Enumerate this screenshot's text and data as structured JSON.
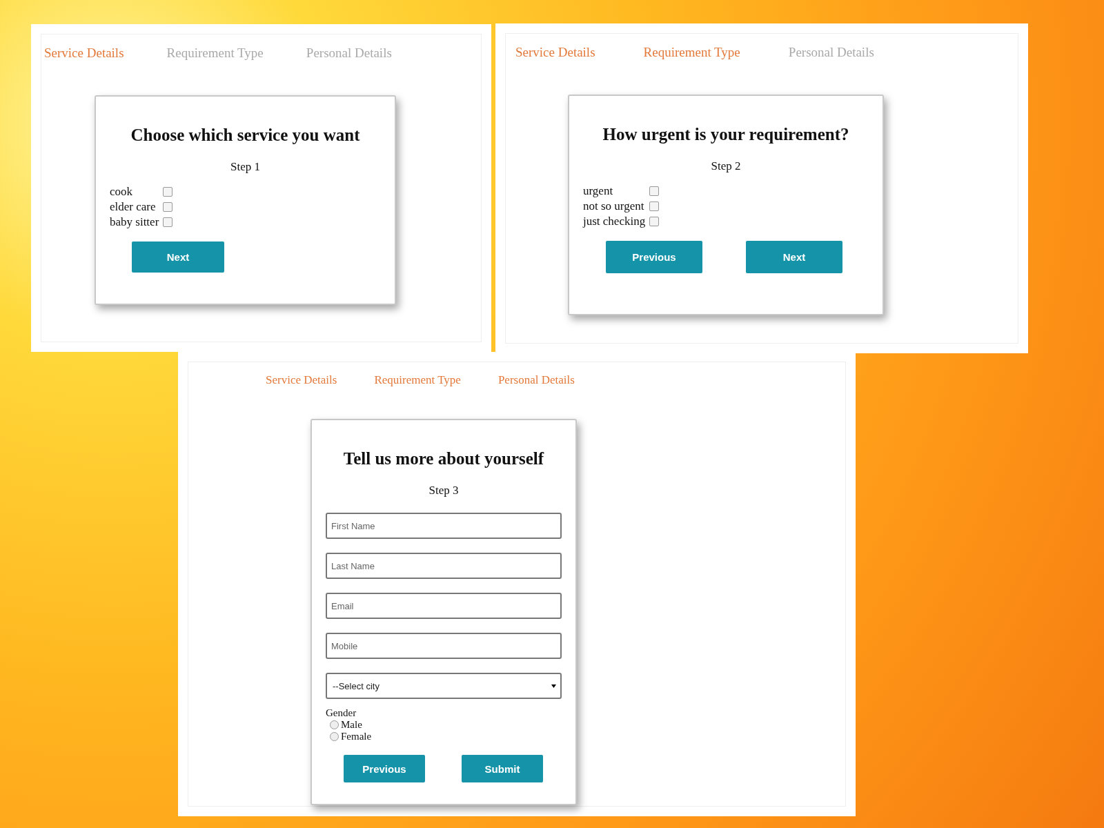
{
  "panels": [
    {
      "tabs": [
        {
          "label": "Service Details",
          "selected": true
        },
        {
          "label": "Requirement Type",
          "selected": false
        },
        {
          "label": "Personal Details",
          "selected": false
        }
      ],
      "title": "Choose which service you want",
      "step": "Step 1",
      "options": [
        {
          "label": "cook",
          "checked": false
        },
        {
          "label": "elder care",
          "checked": false
        },
        {
          "label": "baby sitter",
          "checked": false
        }
      ],
      "buttons": [
        {
          "label": "Next"
        }
      ]
    },
    {
      "tabs": [
        {
          "label": "Service Details",
          "selected": true
        },
        {
          "label": "Requirement Type",
          "selected": true
        },
        {
          "label": "Personal Details",
          "selected": false
        }
      ],
      "title": "How urgent is your requirement?",
      "step": "Step 2",
      "options": [
        {
          "label": "urgent",
          "checked": false
        },
        {
          "label": "not so urgent",
          "checked": false
        },
        {
          "label": "just checking",
          "checked": false
        }
      ],
      "buttons": [
        {
          "label": "Previous"
        },
        {
          "label": "Next"
        }
      ]
    },
    {
      "tabs": [
        {
          "label": "Service Details",
          "selected": true
        },
        {
          "label": "Requirement Type",
          "selected": true
        },
        {
          "label": "Personal Details",
          "selected": true
        }
      ],
      "title": "Tell us more about yourself",
      "step": "Step 3",
      "fields": [
        {
          "kind": "text",
          "placeholder": "First Name"
        },
        {
          "kind": "text",
          "placeholder": "Last Name"
        },
        {
          "kind": "text",
          "placeholder": "Email"
        },
        {
          "kind": "text",
          "placeholder": "Mobile"
        },
        {
          "kind": "select",
          "value": "--Select city"
        }
      ],
      "gender": {
        "label": "Gender",
        "options": [
          {
            "label": "Male",
            "selected": false
          },
          {
            "label": "Female",
            "selected": false
          }
        ]
      },
      "buttons": [
        {
          "label": "Previous"
        },
        {
          "label": "Submit"
        }
      ]
    }
  ]
}
